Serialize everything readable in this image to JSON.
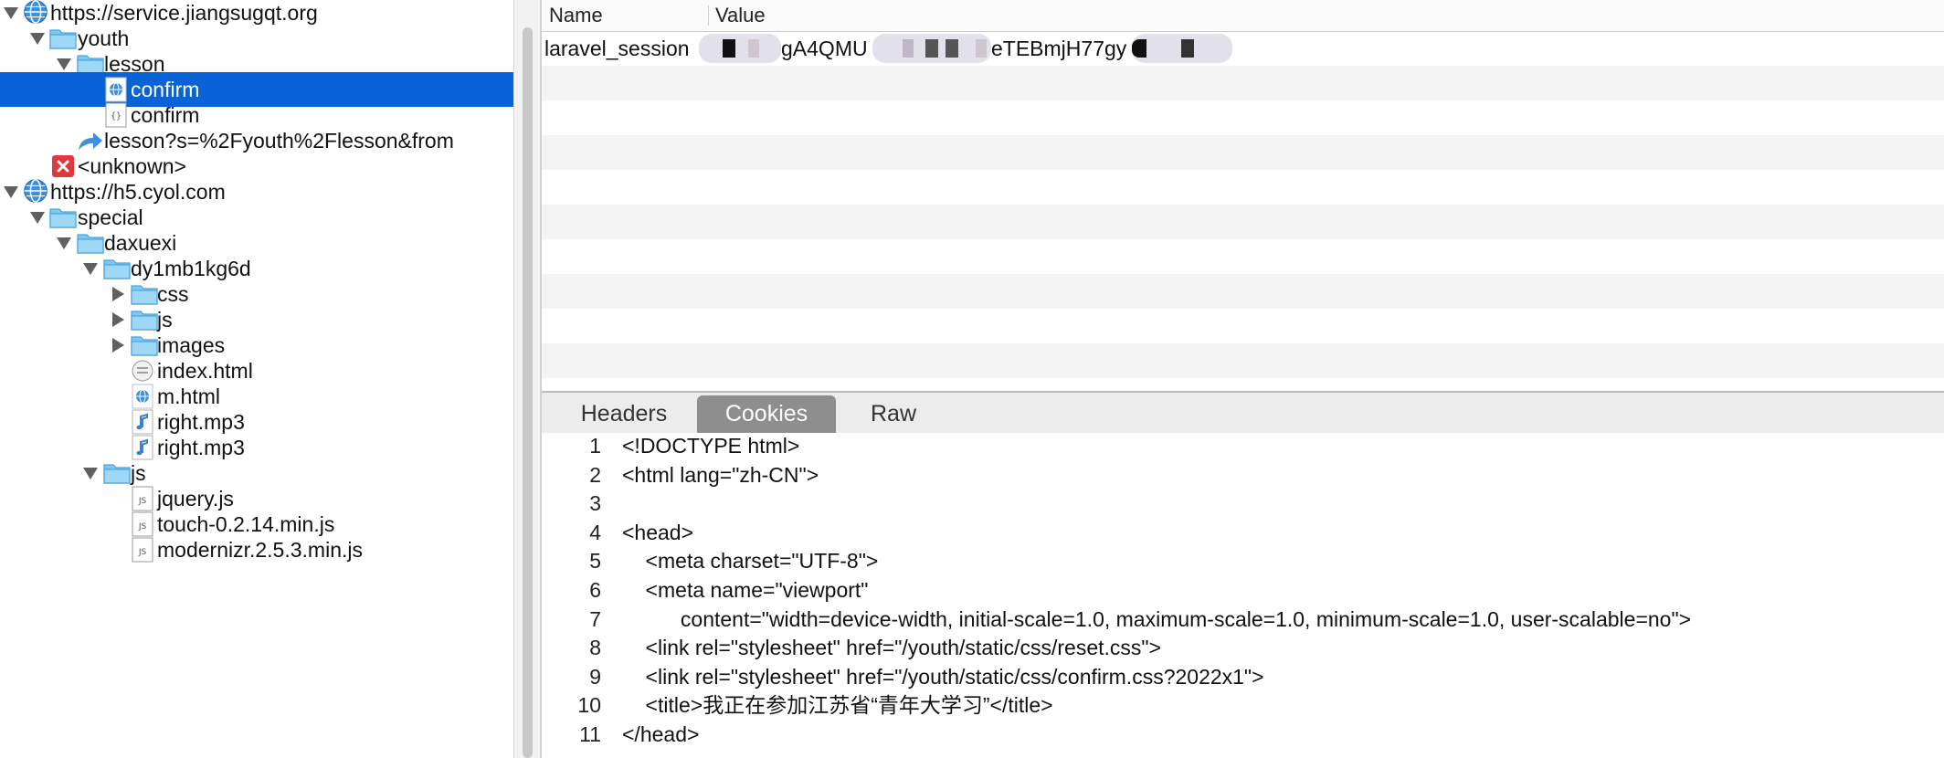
{
  "tree": {
    "items": [
      {
        "label": "https://service.jiangsugqt.org",
        "icon": "globe-icon",
        "arrow": "down"
      },
      {
        "label": "youth",
        "icon": "folder-icon",
        "arrow": "down"
      },
      {
        "label": "lesson",
        "icon": "folder-icon",
        "arrow": "down"
      },
      {
        "label": "confirm",
        "icon": "html-page-icon",
        "arrow": "none",
        "selected": true
      },
      {
        "label": "confirm",
        "icon": "json-file-icon",
        "arrow": "none"
      },
      {
        "label": "lesson?s=%2Fyouth%2Flesson&from",
        "icon": "redirect-icon",
        "arrow": "none"
      },
      {
        "label": "<unknown>",
        "icon": "error-icon",
        "arrow": "none"
      },
      {
        "label": "https://h5.cyol.com",
        "icon": "globe-icon",
        "arrow": "down"
      },
      {
        "label": "special",
        "icon": "folder-icon",
        "arrow": "down"
      },
      {
        "label": "daxuexi",
        "icon": "folder-icon",
        "arrow": "down"
      },
      {
        "label": "dy1mb1kg6d",
        "icon": "folder-icon",
        "arrow": "down"
      },
      {
        "label": "css",
        "icon": "folder-icon",
        "arrow": "right"
      },
      {
        "label": "js",
        "icon": "folder-icon",
        "arrow": "right"
      },
      {
        "label": "images",
        "icon": "folder-icon",
        "arrow": "right"
      },
      {
        "label": "index.html",
        "icon": "text-file-icon",
        "arrow": "none"
      },
      {
        "label": "m.html",
        "icon": "html-page-icon",
        "arrow": "none"
      },
      {
        "label": "right.mp3",
        "icon": "audio-file-icon",
        "arrow": "none"
      },
      {
        "label": "right.mp3",
        "icon": "audio-file-icon",
        "arrow": "none"
      },
      {
        "label": "js",
        "icon": "folder-icon",
        "arrow": "down"
      },
      {
        "label": "jquery.js",
        "icon": "js-file-icon",
        "arrow": "none"
      },
      {
        "label": "touch-0.2.14.min.js",
        "icon": "js-file-icon",
        "arrow": "none"
      },
      {
        "label": "modernizr.2.5.3.min.js",
        "icon": "js-file-icon",
        "arrow": "none"
      }
    ]
  },
  "table": {
    "columns": [
      "Name",
      "Value"
    ],
    "row": {
      "name": "laravel_session",
      "value_parts": [
        "gA4QMU",
        "eTEBmjH77gy"
      ]
    }
  },
  "tabs": [
    {
      "label": "Headers",
      "active": false
    },
    {
      "label": "Cookies",
      "active": true
    },
    {
      "label": "Raw",
      "active": false
    }
  ],
  "code": {
    "lines": [
      {
        "n": "1",
        "text": "<!DOCTYPE html>"
      },
      {
        "n": "2",
        "text": "<html lang=\"zh-CN\">"
      },
      {
        "n": "3",
        "text": ""
      },
      {
        "n": "4",
        "text": "<head>"
      },
      {
        "n": "5",
        "text": "    <meta charset=\"UTF-8\">"
      },
      {
        "n": "6",
        "text": "    <meta name=\"viewport\""
      },
      {
        "n": "7",
        "text": "          content=\"width=device-width, initial-scale=1.0, maximum-scale=1.0, minimum-scale=1.0, user-scalable=no\">"
      },
      {
        "n": "8",
        "text": "    <link rel=\"stylesheet\" href=\"/youth/static/css/reset.css\">"
      },
      {
        "n": "9",
        "text": "    <link rel=\"stylesheet\" href=\"/youth/static/css/confirm.css?2022x1\">"
      },
      {
        "n": "10",
        "text": "    <title>我正在参加江苏省“青年大学习”</title>"
      },
      {
        "n": "11",
        "text": "</head>"
      }
    ]
  },
  "colors": {
    "selection": "#0a63d6",
    "folder": "#7ec8f2",
    "active_tab": "#8e8e8e"
  }
}
